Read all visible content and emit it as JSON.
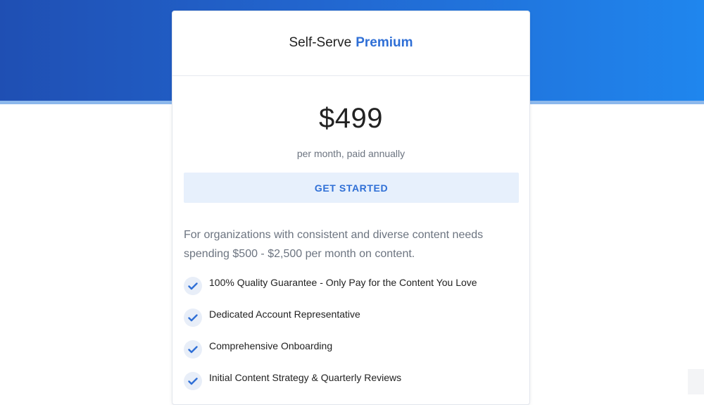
{
  "plan": {
    "prefix": "Self-Serve",
    "name": "Premium"
  },
  "pricing": {
    "price": "$499",
    "billing": "per month, paid annually"
  },
  "cta": {
    "label": "GET STARTED"
  },
  "description": "For organizations with consistent and diverse content needs spending $500 - $2,500 per month on content.",
  "features": [
    {
      "label": "100% Quality Guarantee - Only Pay for the Content You Love",
      "icon": "check-icon"
    },
    {
      "label": "Dedicated Account Representative",
      "icon": "check-icon"
    },
    {
      "label": "Comprehensive Onboarding",
      "icon": "check-icon"
    },
    {
      "label": "Initial Content Strategy & Quarterly Reviews",
      "icon": "check-icon"
    }
  ],
  "colors": {
    "accent": "#2f6fd6",
    "hero_start": "#1f4fb3",
    "hero_end": "#1f86ee",
    "cta_background": "#e7f0fc",
    "muted_text": "#6c7480"
  }
}
